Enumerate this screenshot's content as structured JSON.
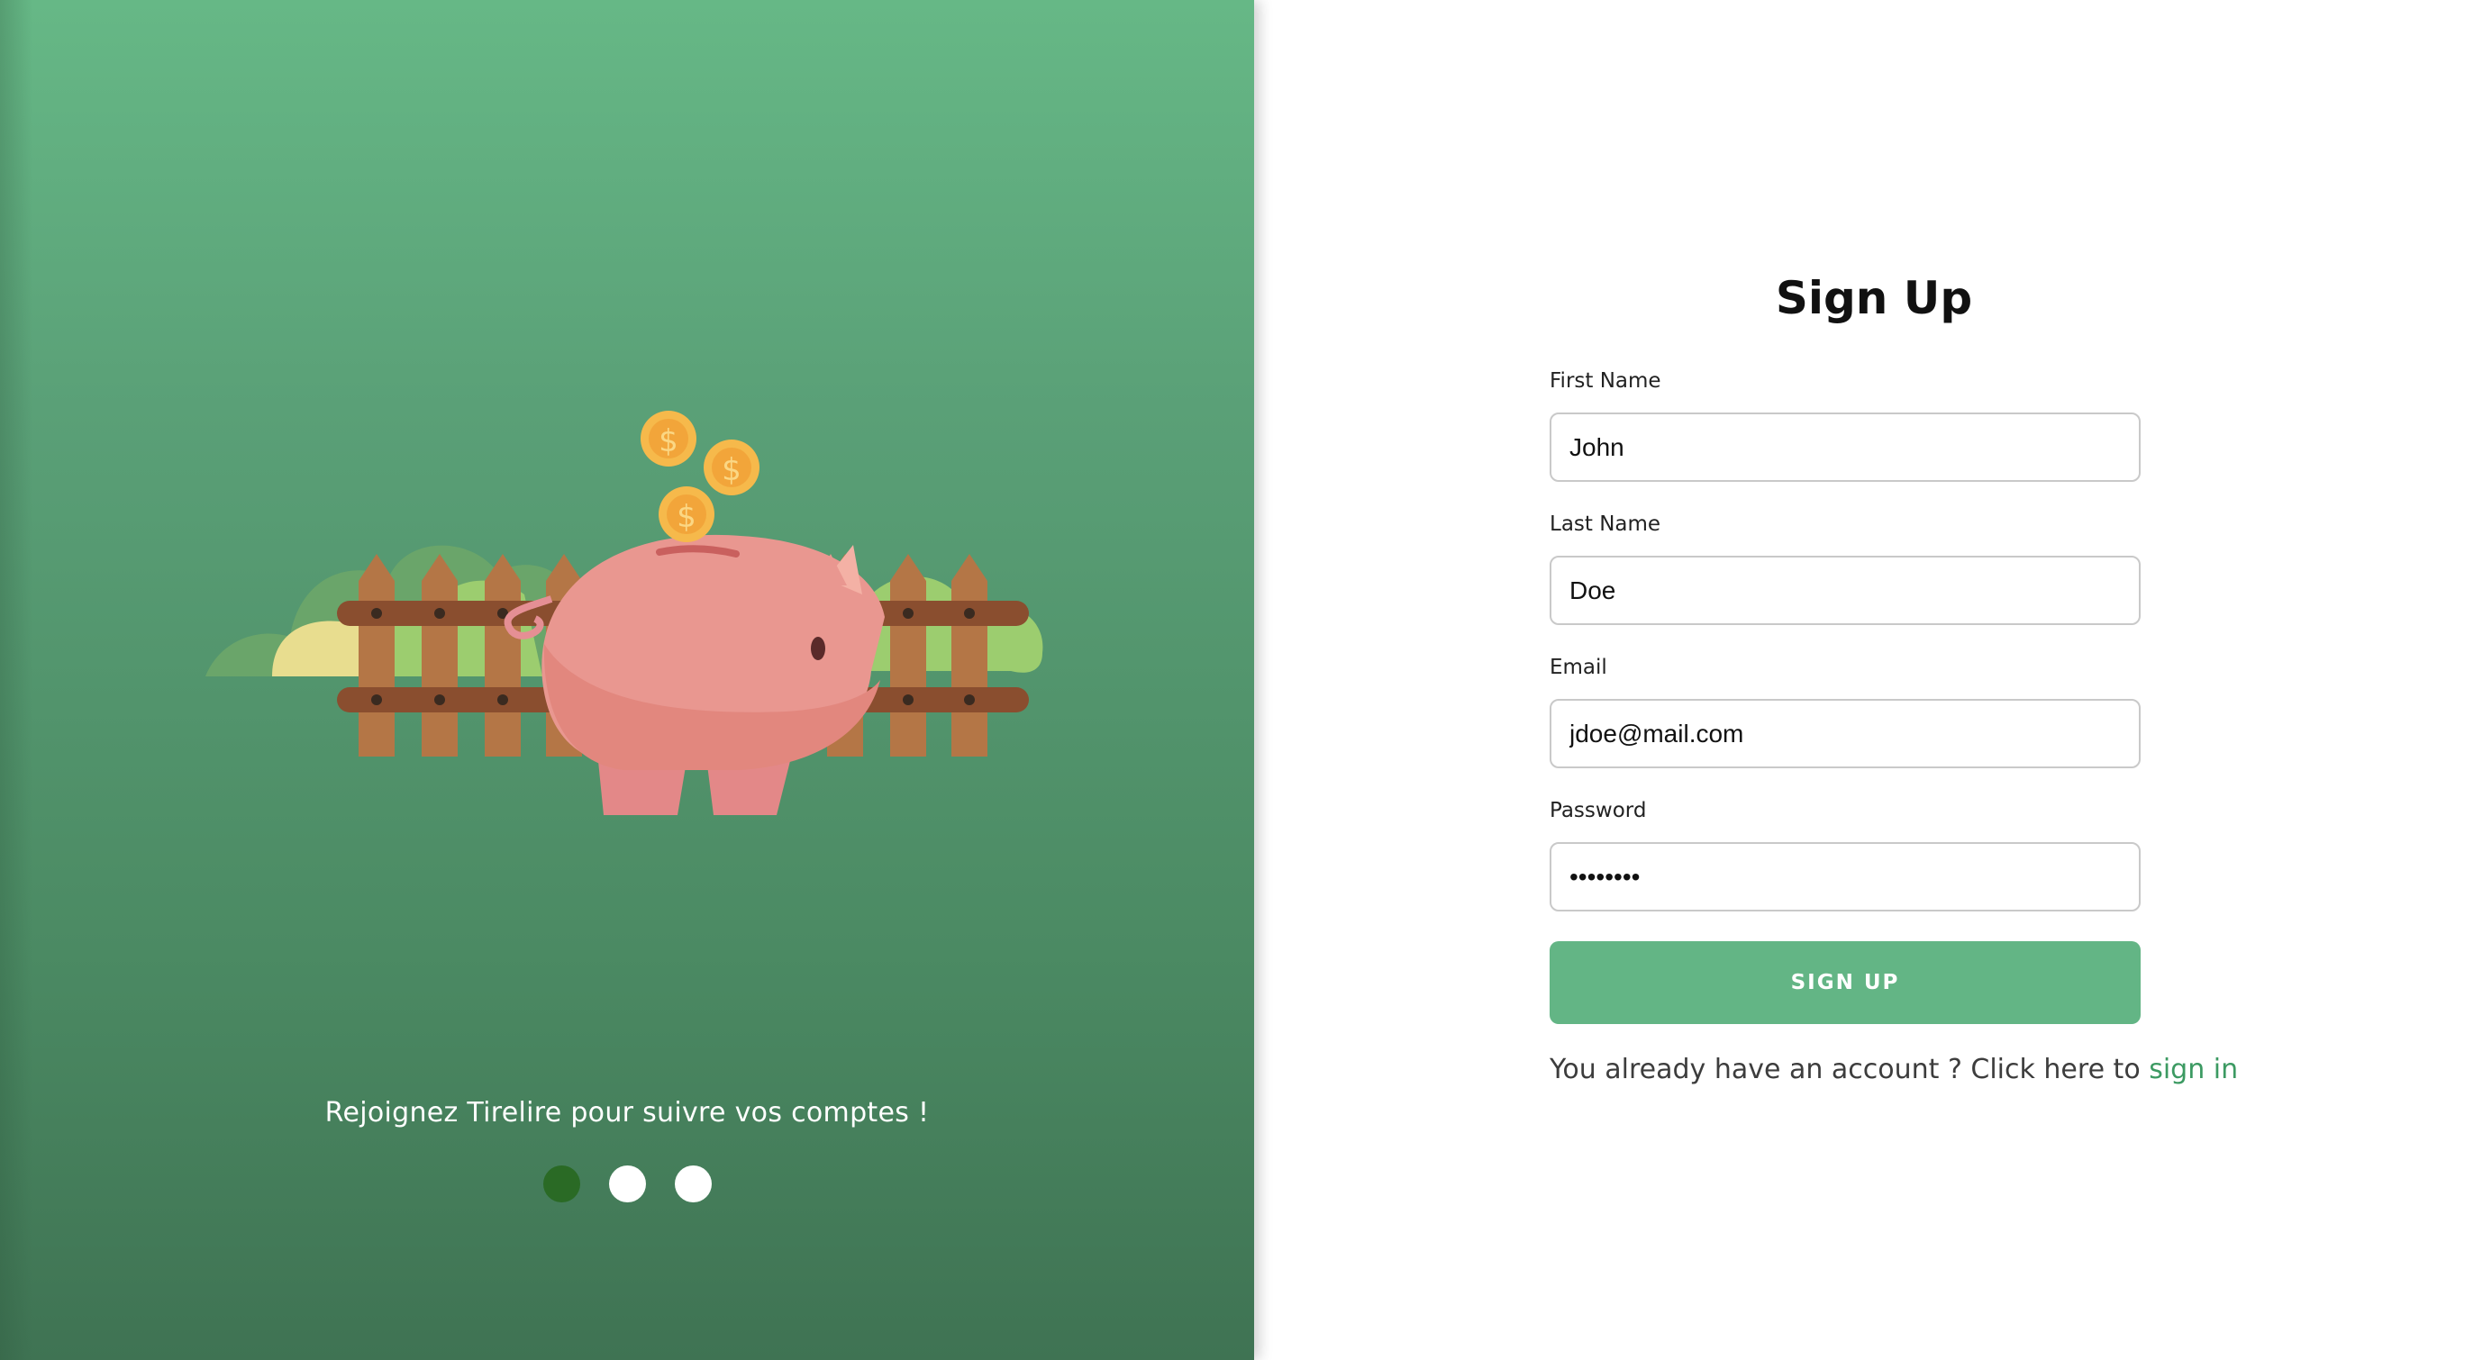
{
  "illustration": {
    "coin_symbol": "$",
    "icon": "piggy-bank-illustration"
  },
  "onboarding": {
    "tagline": "Rejoignez Tirelire pour suivre vos comptes !",
    "dots_total": 3,
    "dots_active_index": 0
  },
  "form": {
    "title": "Sign Up",
    "fields": {
      "first_name": {
        "label": "First Name",
        "value": "John"
      },
      "last_name": {
        "label": "Last Name",
        "value": "Doe"
      },
      "email": {
        "label": "Email",
        "value": "jdoe@mail.com"
      },
      "password": {
        "label": "Password",
        "value": "••••••••"
      }
    },
    "submit_label": "SIGN UP",
    "signin_prompt": "You already have an account ? Click here to ",
    "signin_link": "sign in"
  },
  "colors": {
    "brand_green": "#63b585",
    "active_dot": "#2a6a25",
    "link_green": "#3c9a62",
    "panel_top": "#66b886",
    "panel_bottom": "#3f7353"
  }
}
